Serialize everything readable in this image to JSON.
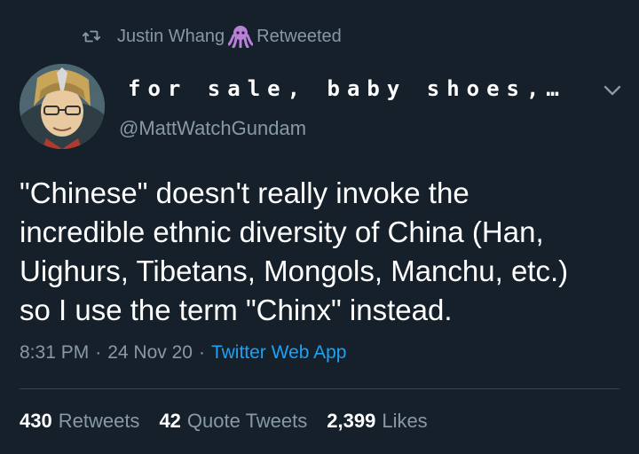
{
  "retweet": {
    "icon": "retweet-icon",
    "user": "Justin Whang",
    "user_icon": "octopus-emoji-icon",
    "label": "Retweeted"
  },
  "author": {
    "avatar": "anime-character-avatar",
    "display_name": "for sale, baby shoes,…",
    "handle": "@MattWatchGundam",
    "menu_icon": "chevron-down-icon"
  },
  "tweet": {
    "line1": "\"Chinese\" doesn't really invoke the",
    "line2": "incredible ethnic diversity of China (Han,",
    "line3": "Uighurs, Tibetans, Mongols, Manchu, etc.)",
    "line4": "so I use the term \"Chinx\" instead."
  },
  "meta": {
    "time": "8:31 PM",
    "separator": "·",
    "date": "24 Nov 20",
    "source": "Twitter Web App"
  },
  "stats": {
    "retweets_count": "430",
    "retweets_label": "Retweets",
    "quotes_count": "42",
    "quotes_label": "Quote Tweets",
    "likes_count": "2,399",
    "likes_label": "Likes"
  },
  "colors": {
    "background": "#15202b",
    "secondary_text": "#8899a6",
    "link": "#1da1f2",
    "octopus": "#b980d8",
    "divider": "#38444d"
  }
}
